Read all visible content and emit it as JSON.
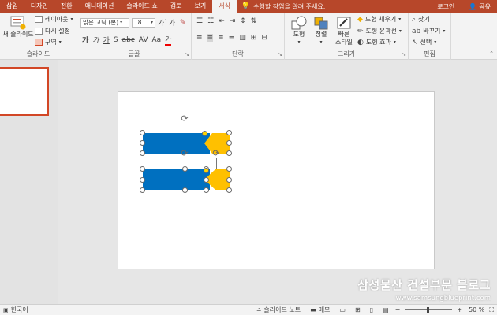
{
  "tabs": [
    "삽입",
    "디자인",
    "전환",
    "애니메이션",
    "슬라이드 쇼",
    "검토",
    "보기",
    "서식"
  ],
  "active_tab_index": 7,
  "tell_me": "수행할 작업을 알려 주세요.",
  "login": "로그인",
  "share": "공유",
  "ribbon": {
    "slides": {
      "new_slide": "새 슬라이드",
      "layout": "레이아웃",
      "reset": "다시 설정",
      "section": "구역",
      "label": "슬라이드"
    },
    "font": {
      "name": "맑은 고딕 (본)",
      "size": "18",
      "label": "글꼴"
    },
    "paragraph": {
      "label": "단락"
    },
    "drawing": {
      "shapes": "도형",
      "arrange": "정렬",
      "quick_styles_1": "빠른",
      "quick_styles_2": "스타일",
      "fill": "도형 채우기",
      "outline": "도형 윤곽선",
      "effects": "도형 효과",
      "label": "그리기"
    },
    "editing": {
      "find": "찾기",
      "replace": "바꾸기",
      "select": "선택",
      "label": "편집"
    }
  },
  "watermark": {
    "line1": "삼성물산 건설부문 블로그",
    "line2": "www.samsungblueprint.com"
  },
  "statusbar": {
    "language": "한국어",
    "notes": "슬라이드 노트",
    "comments": "메모",
    "zoom_minus": "−",
    "zoom_plus": "+",
    "zoom": "50 %"
  },
  "colors": {
    "accent": "#b7472a",
    "shape_blue": "#0070c0",
    "shape_orange": "#ffc000"
  }
}
